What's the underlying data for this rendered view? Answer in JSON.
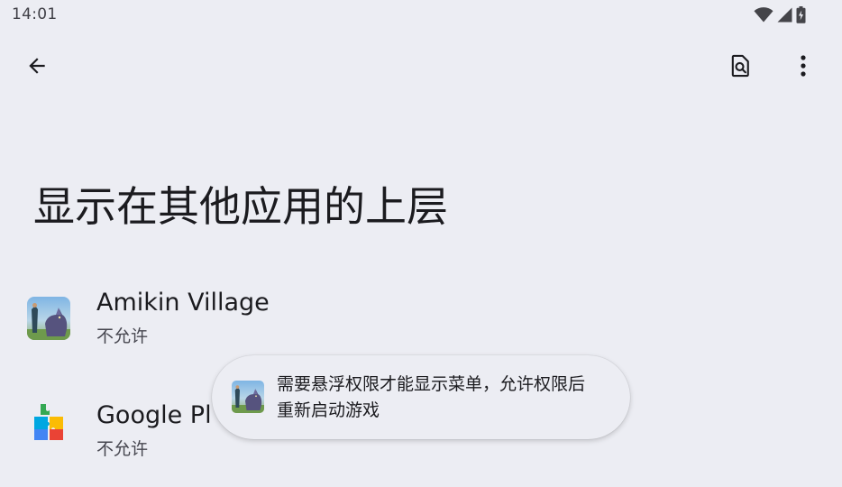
{
  "status_bar": {
    "time": "14:01",
    "icons": [
      "wifi-icon",
      "signal-icon",
      "battery-icon"
    ]
  },
  "app_bar": {
    "back_icon": "arrow-back-icon",
    "search_icon": "search-in-page-icon",
    "more_icon": "more-vert-icon"
  },
  "page": {
    "title": "显示在其他应用的上层"
  },
  "apps": [
    {
      "name": "Amikin Village",
      "status": "不允许",
      "icon": "amikin-village-app-icon"
    },
    {
      "name": "Google Pl",
      "status": "不允许",
      "icon": "google-play-services-icon"
    }
  ],
  "toast": {
    "icon": "amikin-village-app-icon",
    "line1": "需要悬浮权限才能显示菜单，允许权限后",
    "line2": "重新启动游戏"
  },
  "colors": {
    "background": "#ECEDF3",
    "text_primary": "#1B1B1F",
    "text_secondary": "#46464F"
  }
}
